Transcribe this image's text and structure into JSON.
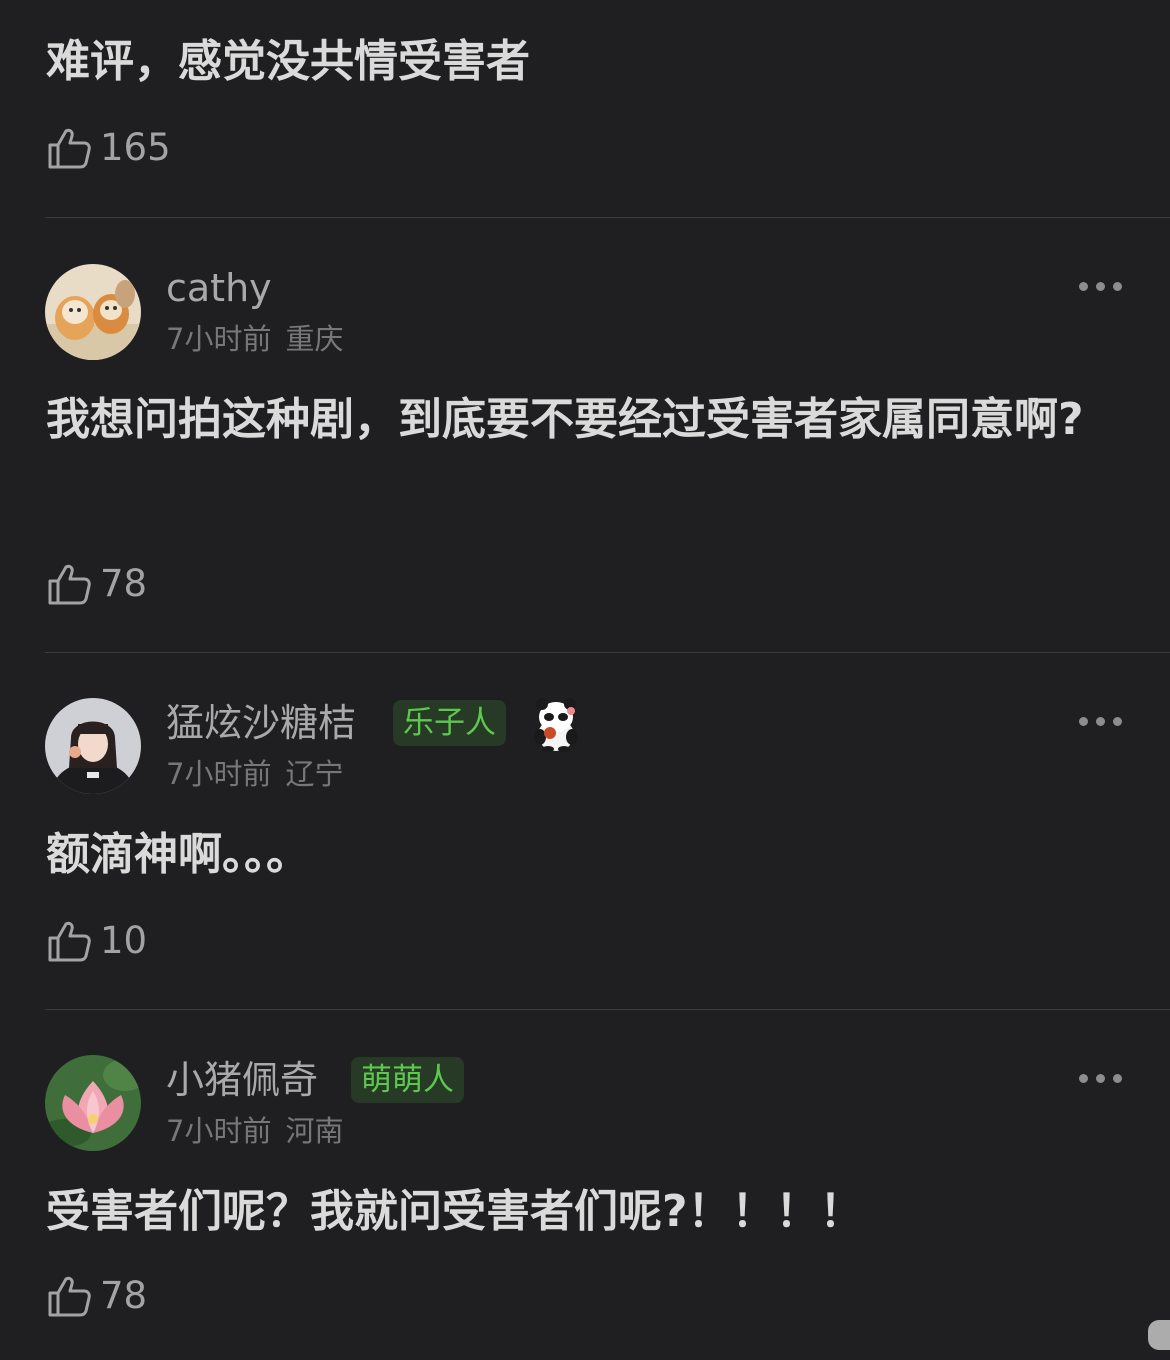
{
  "comments": [
    {
      "text": "难评，感觉没共情受害者",
      "likes": "165"
    },
    {
      "username": "cathy",
      "time": "7小时前",
      "location": "重庆",
      "text": "我想问拍这种剧，到底要不要经过受害者家属同意啊?",
      "likes": "78",
      "avatar_icon": "cats-photo-avatar"
    },
    {
      "username": "猛炫沙糖桔",
      "badge": "乐子人",
      "sticker_icon": "panda-sticker-icon",
      "time": "7小时前",
      "location": "辽宁",
      "text": "额滴神啊。。。",
      "likes": "10",
      "avatar_icon": "girl-photo-avatar"
    },
    {
      "username": "小猪佩奇",
      "badge": "萌萌人",
      "time": "7小时前",
      "location": "河南",
      "text": "受害者们呢？我就问受害者们呢?！！！！",
      "likes": "78",
      "avatar_icon": "lotus-photo-avatar"
    }
  ],
  "colors": {
    "background": "#1f1f21",
    "badge_bg": "#263a25",
    "badge_text": "#5cc84e",
    "divider": "#3a3a3d"
  }
}
